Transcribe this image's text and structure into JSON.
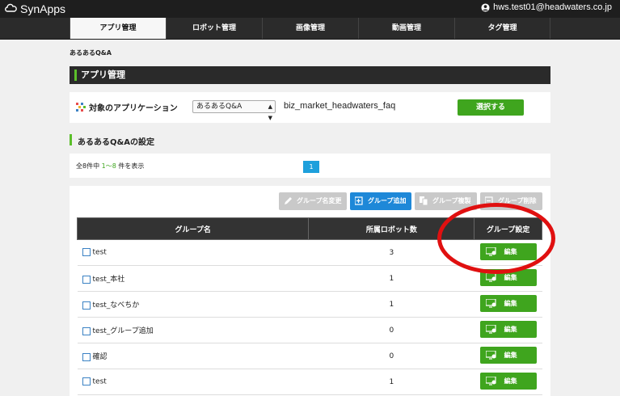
{
  "app": {
    "logo_text": "SynApps",
    "user_email": "hws.test01@headwaters.co.jp"
  },
  "nav": {
    "tabs": [
      "アプリ管理",
      "ロボット管理",
      "画像管理",
      "動画管理",
      "タグ管理"
    ],
    "active_index": 0
  },
  "breadcrumb": "あるあるQ&A",
  "app_section": {
    "title": "アプリ管理",
    "target_label": "対象のアプリケーション",
    "selected_app": "あるあるQ&A",
    "app_id": "biz_market_headwaters_faq",
    "select_button": "選択する"
  },
  "settings_section": {
    "title": "あるあるQ&Aの設定",
    "count_prefix": "全8件中 ",
    "count_range": "1〜8",
    "count_suffix": " 件を表示",
    "page": "1"
  },
  "toolbar": {
    "rename": "グループ名変更",
    "add": "グループ追加",
    "copy": "グループ複製",
    "delete": "グループ削除"
  },
  "table": {
    "headers": [
      "グループ名",
      "所属ロボット数",
      "グループ設定"
    ],
    "edit_label": "編集",
    "rows": [
      {
        "name": "test",
        "count": "3"
      },
      {
        "name": "test_本社",
        "count": "1"
      },
      {
        "name": "test_なべちか",
        "count": "1"
      },
      {
        "name": "test_グループ追加",
        "count": "0"
      },
      {
        "name": "確認",
        "count": "0"
      },
      {
        "name": "test",
        "count": "1"
      }
    ]
  },
  "colors": {
    "accent_green": "#3fa51e",
    "accent_blue": "#1e88d8",
    "highlight_red": "#e01010",
    "header_dark": "#2a2a2a"
  }
}
